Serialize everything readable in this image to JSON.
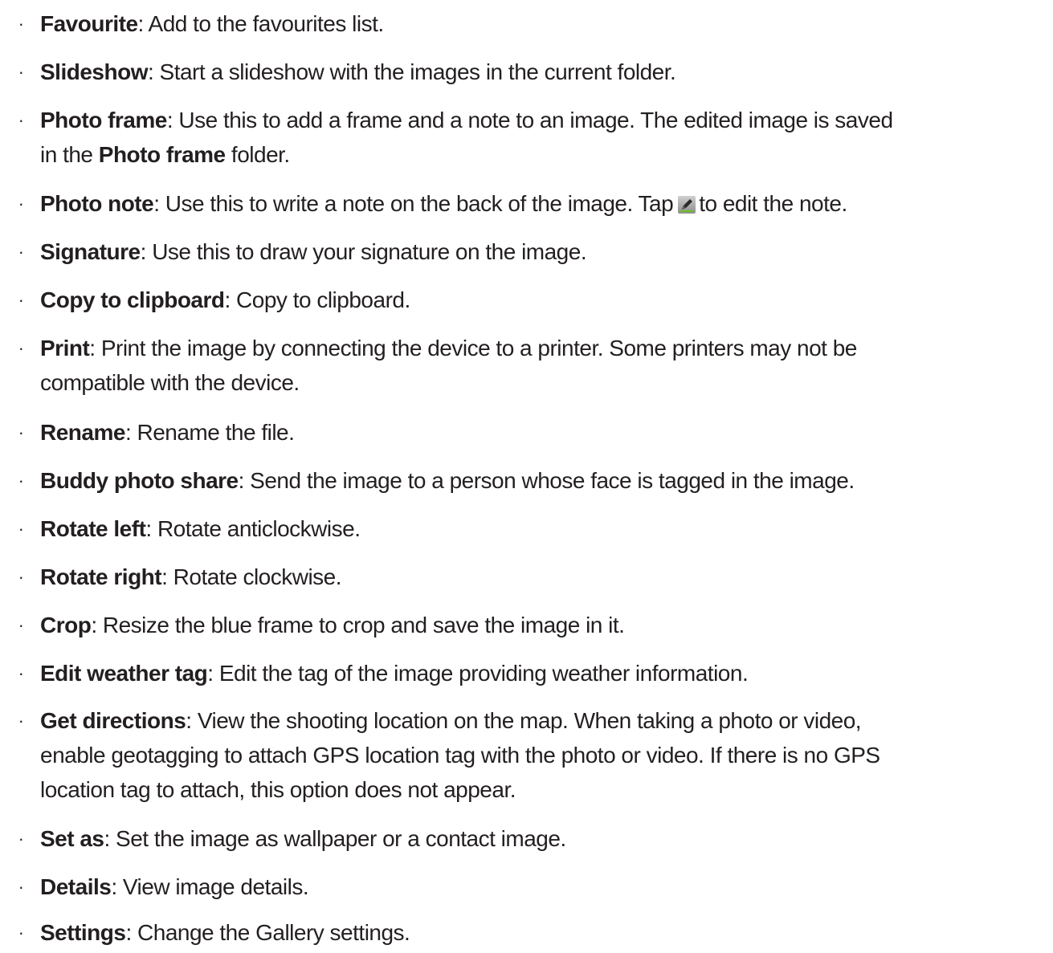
{
  "items": [
    {
      "term": "Favourite",
      "desc": ": Add to the favourites list."
    },
    {
      "term": "Slideshow",
      "desc": ": Start a slideshow with the images in the current folder."
    },
    {
      "term": "Photo frame",
      "desc": ": Use this to add a frame and a note to an image. The edited image is saved",
      "desc_line2_pre": "in the ",
      "desc_line2_term": "Photo frame",
      "desc_line2_post": " folder."
    },
    {
      "term": "Photo note",
      "desc": ": Use this to write a note on the back of the image. Tap",
      "desc_after_icon": "to edit the note.",
      "icon": "edit-pencil-icon"
    },
    {
      "term": "Signature",
      "desc": ": Use this to draw your signature on the image."
    },
    {
      "term": "Copy to clipboard",
      "desc": ": Copy to clipboard."
    },
    {
      "term": "Print",
      "desc": ": Print the image by connecting the device to a printer. Some printers may not be",
      "desc_line2": "compatible with the device."
    },
    {
      "term": "Rename",
      "desc": ": Rename the file."
    },
    {
      "term": "Buddy photo share",
      "desc": ": Send the image to a person whose face is tagged in the image."
    },
    {
      "term": "Rotate left",
      "desc": ": Rotate anticlockwise."
    },
    {
      "term": "Rotate right",
      "desc": ": Rotate clockwise."
    },
    {
      "term": "Crop",
      "desc": ": Resize the blue frame to crop and save the image in it."
    },
    {
      "term": "Edit weather tag",
      "desc": ": Edit the tag of the image providing weather information."
    },
    {
      "term": "Get directions",
      "desc": ": View the shooting location on the map. When taking a photo or video,",
      "desc_line2": "enable geotagging to attach GPS location tag with the photo or video. If there is no GPS",
      "desc_line3": "location tag to attach, this option does not appear."
    },
    {
      "term": "Set as",
      "desc": ": Set the image as wallpaper or a contact image."
    },
    {
      "term": "Details",
      "desc": ": View image details."
    },
    {
      "term": "Settings",
      "desc": ": Change the Gallery settings."
    }
  ],
  "bullet_glyph": "·"
}
